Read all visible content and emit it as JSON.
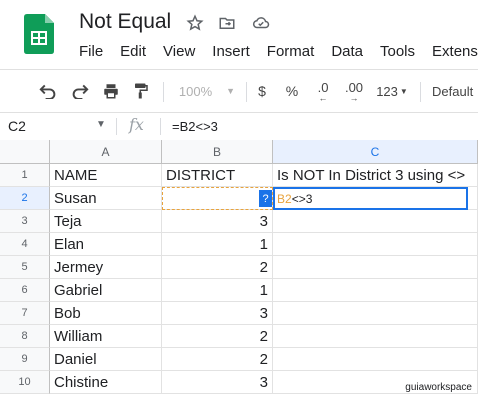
{
  "app": {
    "title": "Not Equal",
    "menu": [
      "File",
      "Edit",
      "View",
      "Insert",
      "Format",
      "Data",
      "Tools",
      "Extens"
    ]
  },
  "toolbar": {
    "zoom": "100%",
    "currency": "$",
    "percent": "%",
    "dec_decrease": ".0",
    "dec_increase": ".00",
    "more_formats": "123",
    "font": "Default"
  },
  "formula_bar": {
    "name_box": "C2",
    "fx": "fx",
    "formula": "=B2<>3"
  },
  "sheet": {
    "columns": [
      "A",
      "B",
      "C"
    ],
    "row_numbers": [
      "1",
      "2",
      "3",
      "4",
      "5",
      "6",
      "7",
      "8",
      "9",
      "10"
    ],
    "headers": [
      "NAME",
      "DISTRICT",
      "Is NOT In District 3 using <>"
    ],
    "rows": [
      {
        "name": "Susan",
        "district": ""
      },
      {
        "name": "Teja",
        "district": "3"
      },
      {
        "name": "Elan",
        "district": "1"
      },
      {
        "name": "Jermey",
        "district": "2"
      },
      {
        "name": "Gabriel",
        "district": "1"
      },
      {
        "name": "Bob",
        "district": "3"
      },
      {
        "name": "William",
        "district": "2"
      },
      {
        "name": "Daniel",
        "district": "2"
      },
      {
        "name": "Chistine",
        "district": "3"
      }
    ],
    "editing": {
      "ref_part": "B2",
      "operator_part": "<>3",
      "help_badge": "?"
    }
  },
  "watermark": "guiaworkspace",
  "colors": {
    "sheets_green": "#0f9d58",
    "selection_blue": "#1a73e8",
    "ref_orange": "#e8a33d"
  }
}
